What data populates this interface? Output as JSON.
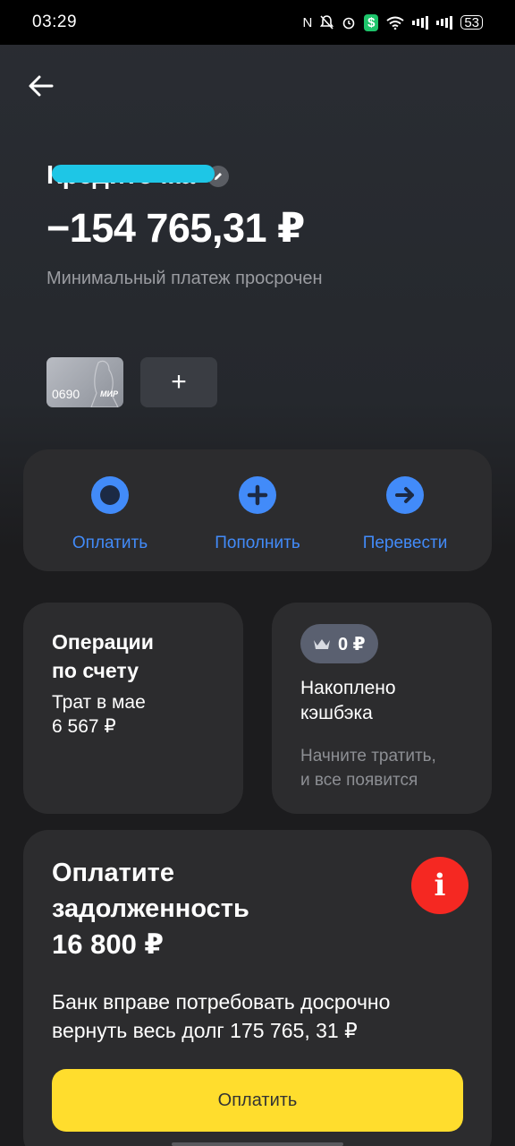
{
  "status_bar": {
    "time": "03:29",
    "battery": "53"
  },
  "account": {
    "title": "Кредиточка",
    "balance": "−154 765,31 ₽",
    "subtitle": "Минимальный платеж просрочен"
  },
  "card": {
    "number": "0690",
    "system": "МИР",
    "add_label": "+"
  },
  "actions": [
    {
      "label": "Оплатить",
      "icon": "circle-icon"
    },
    {
      "label": "Пополнить",
      "icon": "plus-icon"
    },
    {
      "label": "Перевести",
      "icon": "arrow-right-icon"
    }
  ],
  "operations": {
    "title_line1": "Операции",
    "title_line2": "по счету",
    "spent_label": "Трат в мае",
    "spent_value": "6 567 ₽",
    "bar_fill_fraction": 1.0,
    "bar_color": "#1ec6e6"
  },
  "cashback": {
    "badge": "0 ₽",
    "title_line1": "Накоплено",
    "title_line2": "кэшбэка",
    "hint_line1": "Начните тратить,",
    "hint_line2": "и все появится"
  },
  "debt": {
    "title_line1": "Оплатите",
    "title_line2": "задолженность",
    "amount": "16 800 ₽",
    "text_line1": "Банк вправе потребовать досрочно",
    "text_line2": "вернуть весь долг 175 765, 31 ₽",
    "pay_label": "Оплатить",
    "alert_glyph": "i"
  },
  "colors": {
    "accent_blue": "#428bf9",
    "pay_yellow": "#ffdd2d",
    "alert_red": "#f52822"
  }
}
